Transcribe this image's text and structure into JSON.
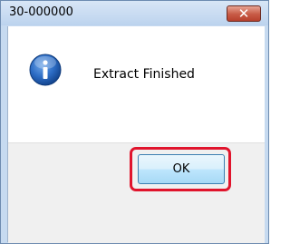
{
  "window": {
    "title": "30-000000",
    "close_label": "✕"
  },
  "message": {
    "icon": "info-icon",
    "text": "Extract Finished"
  },
  "buttons": {
    "ok_label": "OK"
  },
  "colors": {
    "highlight": "#e0142c",
    "info_icon": "#1e5aa8"
  }
}
